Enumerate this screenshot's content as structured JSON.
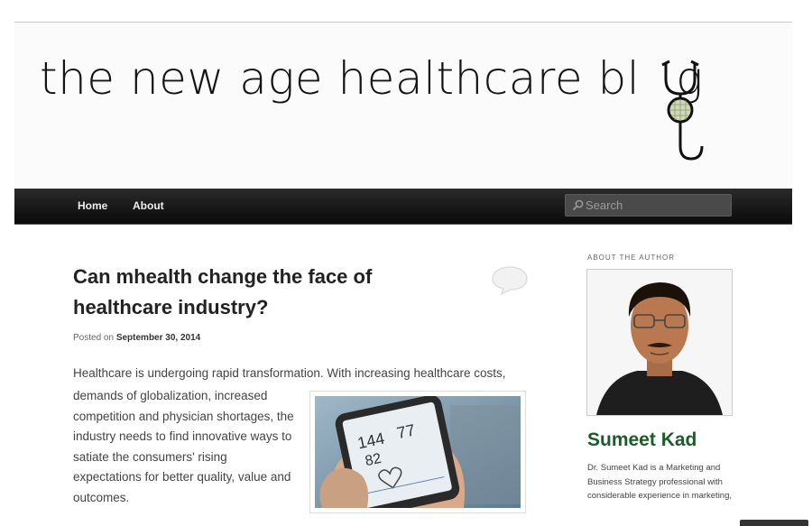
{
  "header": {
    "blog_title": "the new age healthcare bl",
    "blog_title_end": "g"
  },
  "nav": {
    "items": [
      {
        "label": "Home"
      },
      {
        "label": "About"
      }
    ],
    "search_placeholder": "Search"
  },
  "post": {
    "title": "Can mhealth change the face of healthcare industry?",
    "posted_prefix": "Posted on",
    "date": "September 30, 2014",
    "intro": "Healthcare is undergoing rapid transformation. With increasing healthcare costs,",
    "body": "demands of globalization, increased competition and physician shortages, the industry needs to find innovative ways to satiate the consumers' rising expectations for better quality, value and outcomes.",
    "image": {
      "readings": [
        "144",
        "77",
        "82"
      ]
    }
  },
  "sidebar": {
    "widget_title": "ABOUT THE AUTHOR",
    "author_name": "Sumeet Kad",
    "author_bio": "Dr. Sumeet Kad is a Marketing and Business Strategy professional with considerable experience in marketing,"
  },
  "colors": {
    "nav_bg": "#111111",
    "author_name": "#1d5b2a",
    "title": "#222222"
  }
}
